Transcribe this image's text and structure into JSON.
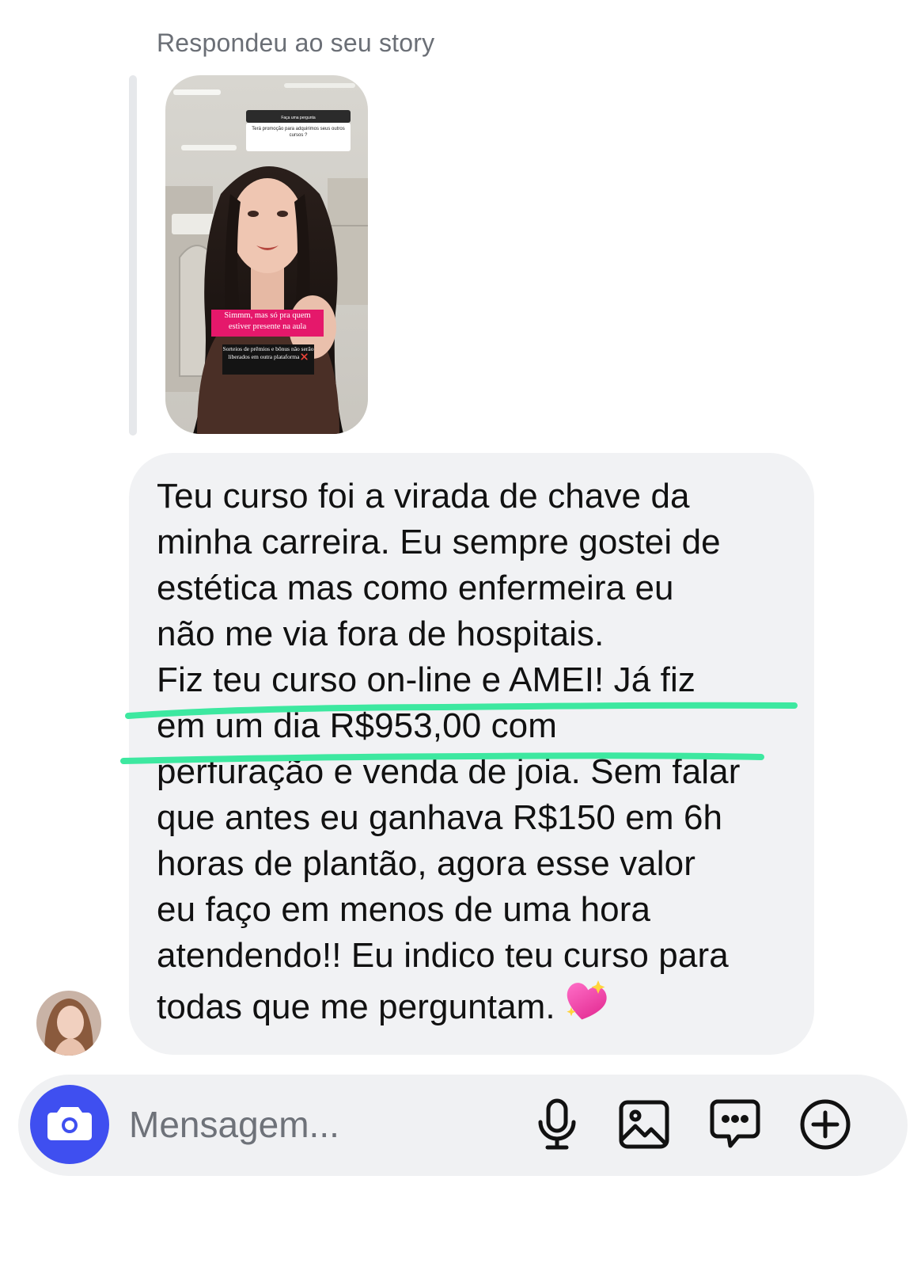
{
  "thread": {
    "reply_label": "Respondeu ao seu story",
    "story": {
      "question_header": "Faça uma pergunta",
      "question_text": "Terá promoção para adquirimos seus outros cursos ?",
      "answer_text": "Simmm, mas só pra quem estiver presente na aula",
      "note_text": "Sorteios de prêmios e bônus não serão liberados em outra plataforma ❌"
    },
    "message": {
      "text": "Teu curso foi a virada de chave da\nminha carreira. Eu sempre gostei de\nestética mas como enfermeira eu\nnão me via fora de hospitais.\nFiz teu curso on-line e AMEI! Já fiz\nem um dia R$953,00 com\nperfuração e venda de joia. Sem falar\nque antes eu ganhava R$150 em 6h\nhoras de plantão, agora esse valor\neu faço em menos de uma hora\natendendo!! Eu indico teu curso para\ntodas que me perguntam.",
      "emoji_icon": "sparkling-heart-icon",
      "highlight_color": "#3de8a0"
    }
  },
  "composer": {
    "placeholder": "Mensagem...",
    "camera_icon": "camera-icon",
    "tools": [
      "microphone-icon",
      "image-icon",
      "sticker-chat-icon",
      "plus-circle-icon"
    ],
    "accent_color": "#3f4ff0"
  }
}
